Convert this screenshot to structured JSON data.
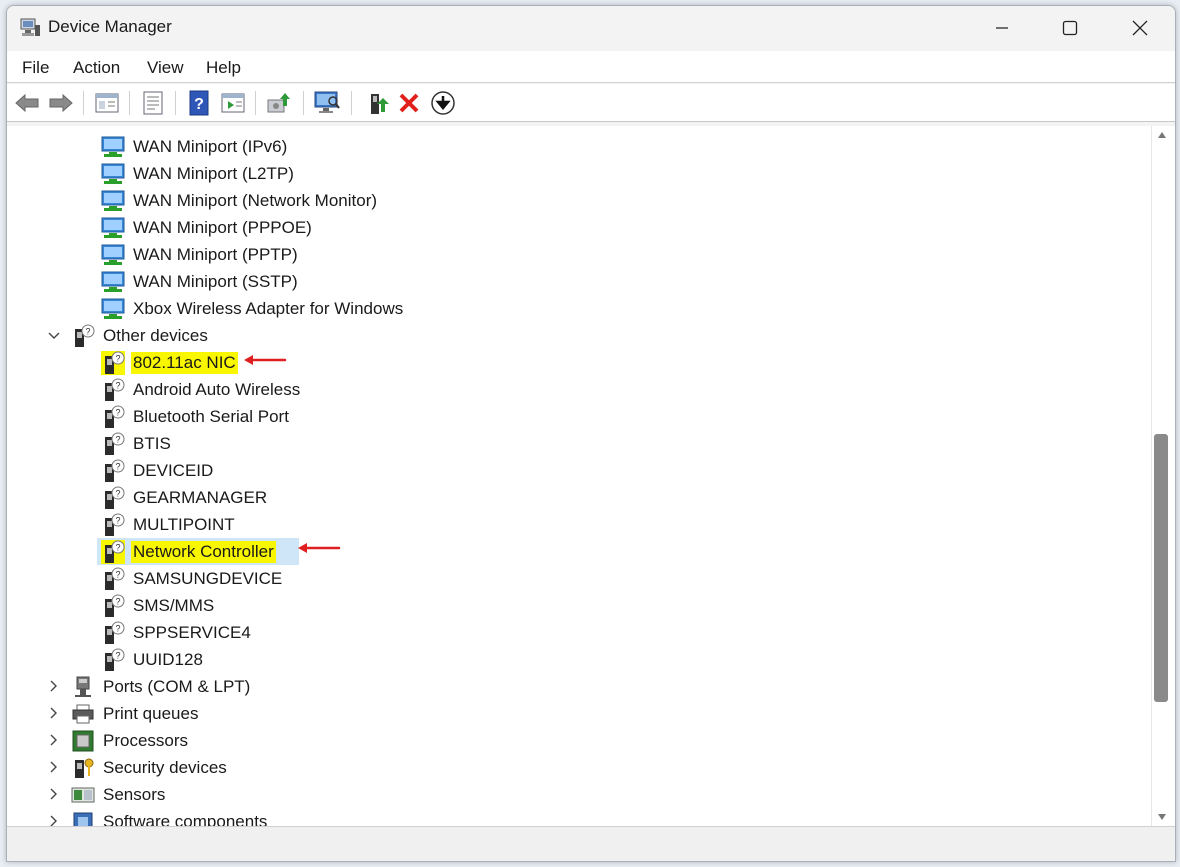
{
  "window": {
    "title": "Device Manager"
  },
  "menu": [
    "File",
    "Action",
    "Help",
    "View"
  ],
  "menu_labels": {
    "file": "File",
    "action": "Action",
    "view": "View",
    "help": "Help"
  },
  "toolbar": {
    "buttons": [
      "back-icon",
      "forward-icon",
      "show-hide-tree-icon",
      "properties-icon",
      "help-icon",
      "view-icon",
      "update-driver-icon",
      "scan-hardware-icon",
      "enable-device-icon",
      "uninstall-device-icon",
      "download-icon"
    ]
  },
  "tree": {
    "network_items": [
      "WAN Miniport (IPv6)",
      "WAN Miniport (L2TP)",
      "WAN Miniport (Network Monitor)",
      "WAN Miniport (PPPOE)",
      "WAN Miniport (PPTP)",
      "WAN Miniport (SSTP)",
      "Xbox Wireless Adapter for Windows"
    ],
    "other_devices": {
      "label": "Other devices",
      "items": [
        "802.11ac NIC",
        "Android Auto Wireless",
        "Bluetooth Serial Port",
        "BTIS",
        "DEVICEID",
        "GEARMANAGER",
        "MULTIPOINT",
        "Network Controller",
        "SAMSUNGDEVICE",
        "SMS/MMS",
        "SPPSERVICE4",
        "UUID128"
      ]
    },
    "categories": [
      "Ports (COM & LPT)",
      "Print queues",
      "Processors",
      "Security devices",
      "Sensors",
      "Software components"
    ]
  },
  "colors": {
    "highlight": "#f8f700",
    "selection": "#cfe6f8",
    "annotation_arrow": "#e02020"
  }
}
